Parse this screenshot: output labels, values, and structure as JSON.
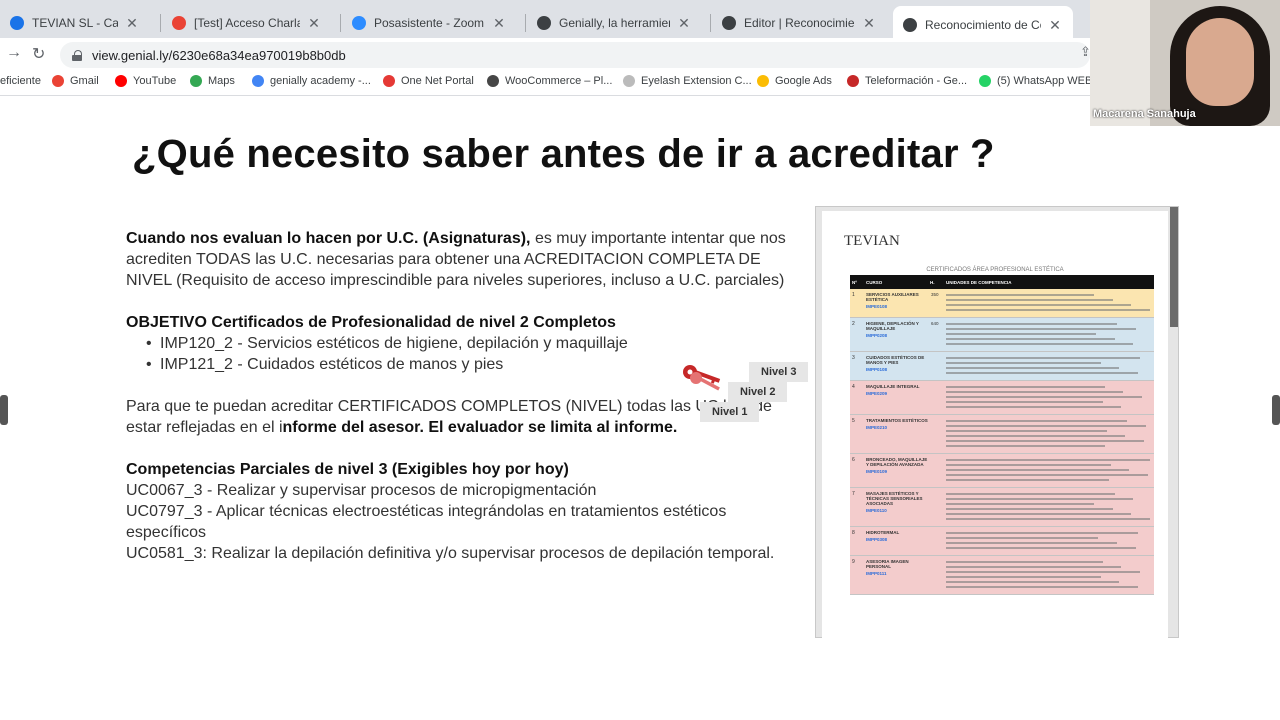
{
  "browser": {
    "tabs": [
      {
        "title": "TEVIAN SL - Calendar - ma",
        "icon": "calendar-icon",
        "color": "#1a73e8"
      },
      {
        "title": "[Test] Acceso Charla Acredi",
        "icon": "gmail-icon",
        "color": "#ea4335"
      },
      {
        "title": "Posasistente - Zoom",
        "icon": "zoom-icon",
        "color": "#2d8cff"
      },
      {
        "title": "Genially, la herramienta par",
        "icon": "genially-icon",
        "color": "#3c4043"
      },
      {
        "title": "Editor | Reconocimiento de",
        "icon": "genially-icon",
        "color": "#3c4043"
      },
      {
        "title": "Reconocimiento de Compe",
        "icon": "genially-icon",
        "color": "#3c4043",
        "active": true
      }
    ],
    "url": "view.genial.ly/6230e68a34ea970019b8b0db",
    "bookmarks": [
      {
        "label": "eficiente",
        "icon": "folder-icon",
        "color": "#5f6368"
      },
      {
        "label": "Gmail",
        "icon": "gmail-icon",
        "color": "#ea4335"
      },
      {
        "label": "YouTube",
        "icon": "youtube-icon",
        "color": "#ff0000"
      },
      {
        "label": "Maps",
        "icon": "maps-icon",
        "color": "#34a853"
      },
      {
        "label": "genially academy -...",
        "icon": "google-icon",
        "color": "#4285f4"
      },
      {
        "label": "One Net Portal",
        "icon": "onenet-icon",
        "color": "#e53935"
      },
      {
        "label": "WooCommerce – Pl...",
        "icon": "wordpress-icon",
        "color": "#464646"
      },
      {
        "label": "Eyelash Extension C...",
        "icon": "loading-icon",
        "color": "#bbbbbb"
      },
      {
        "label": "Google Ads",
        "icon": "google-ads-icon",
        "color": "#fbbc04"
      },
      {
        "label": "Teleformación - Ge...",
        "icon": "gva-icon",
        "color": "#c62828"
      },
      {
        "label": "(5) WhatsApp WEB",
        "icon": "whatsapp-icon",
        "color": "#25d366"
      }
    ]
  },
  "slide": {
    "title": "¿Qué necesito saber antes de ir a acreditar ?",
    "p1_bold": "Cuando nos evaluan lo hacen por U.C. (Asignaturas),",
    "p1_rest": " es muy importante intentar que nos acrediten TODAS las U.C. necesarias para obtener una ACREDITACION COMPLETA DE NIVEL (Requisito de acceso imprescindible para niveles superiores, incluso a U.C. parciales)",
    "objetivo_title": "OBJETIVO Certificados de Profesionalidad de nivel 2 Completos",
    "objetivos": [
      "IMP120_2 - Servicios estéticos de higiene, depilación y maquillaje",
      "IMP121_2 - Cuidados estéticos de manos y pies"
    ],
    "p3_start": "Para que te puedan acreditar CERTIFICADOS COMPLETOS (NIVEL) todas las UC han de estar reflejadas en el i",
    "p3_bold": "nforme del asesor. El evaluador se limita al informe.",
    "comp_title": "Competencias Parciales de nivel 3  (Exigibles hoy por hoy)",
    "competencias": [
      "UC0067_3 - Realizar y supervisar procesos de micropigmentación",
      "UC0797_3 - Aplicar técnicas electroestéticas integrándolas en tratamientos estéticos específicos",
      "UC0581_3: Realizar la depilación definitiva y/o supervisar procesos de depilación temporal."
    ],
    "niveles": [
      "Nivel 3",
      "Nivel 2",
      "Nivel 1"
    ],
    "doc": {
      "logo": "TEVIAN",
      "caption": "CERTIFICADOS ÁREA PROFESIONAL ESTÉTICA",
      "headers": [
        "Nº",
        "CURSO",
        "H.",
        "UNIDADES DE COMPETENCIA"
      ],
      "rows": [
        {
          "n": "1",
          "curso": "SERVICIOS AUXILIARES ESTÉTICA",
          "code": "IMPE0108",
          "h": "350",
          "color": "#fbe5b0",
          "lines": 4
        },
        {
          "n": "2",
          "curso": "HIGIENE, DEPILACIÓN Y MAQUILLAJE",
          "code": "IMPP0208",
          "h": "640",
          "color": "#d3e4ef",
          "lines": 5
        },
        {
          "n": "3",
          "curso": "CUIDADOS ESTÉTICOS DE MANOS Y PIES",
          "code": "IMPP0108",
          "h": "",
          "color": "#d3e4ef",
          "lines": 4
        },
        {
          "n": "4",
          "curso": "MAQUILLAJE INTEGRAL",
          "code": "IMPE0209",
          "h": "",
          "color": "#f3cccc",
          "lines": 5
        },
        {
          "n": "5",
          "curso": "TRATAMIENTOS ESTÉTICOS",
          "code": "IMPE0210",
          "h": "",
          "color": "#f3cccc",
          "lines": 6
        },
        {
          "n": "6",
          "curso": "BRONCEADO, MAQUILLAJE Y DEPILACIÓN AVANZADA",
          "code": "IMPE0109",
          "h": "",
          "color": "#f3cccc",
          "lines": 5
        },
        {
          "n": "7",
          "curso": "MASAJES ESTÉTICOS Y TÉCNICAS SENSORIALES ASOCIADAS",
          "code": "IMPE0110",
          "h": "",
          "color": "#f3cccc",
          "lines": 6
        },
        {
          "n": "8",
          "curso": "HIDROTERMAL",
          "code": "IMPP0308",
          "h": "",
          "color": "#f3cccc",
          "lines": 4
        },
        {
          "n": "9",
          "curso": "ASESORIA IMAGEN PERSONAL",
          "code": "IMPP0111",
          "h": "",
          "color": "#f3cccc",
          "lines": 6
        }
      ]
    }
  },
  "video": {
    "participant_name": "Macarena Sanahuja"
  }
}
